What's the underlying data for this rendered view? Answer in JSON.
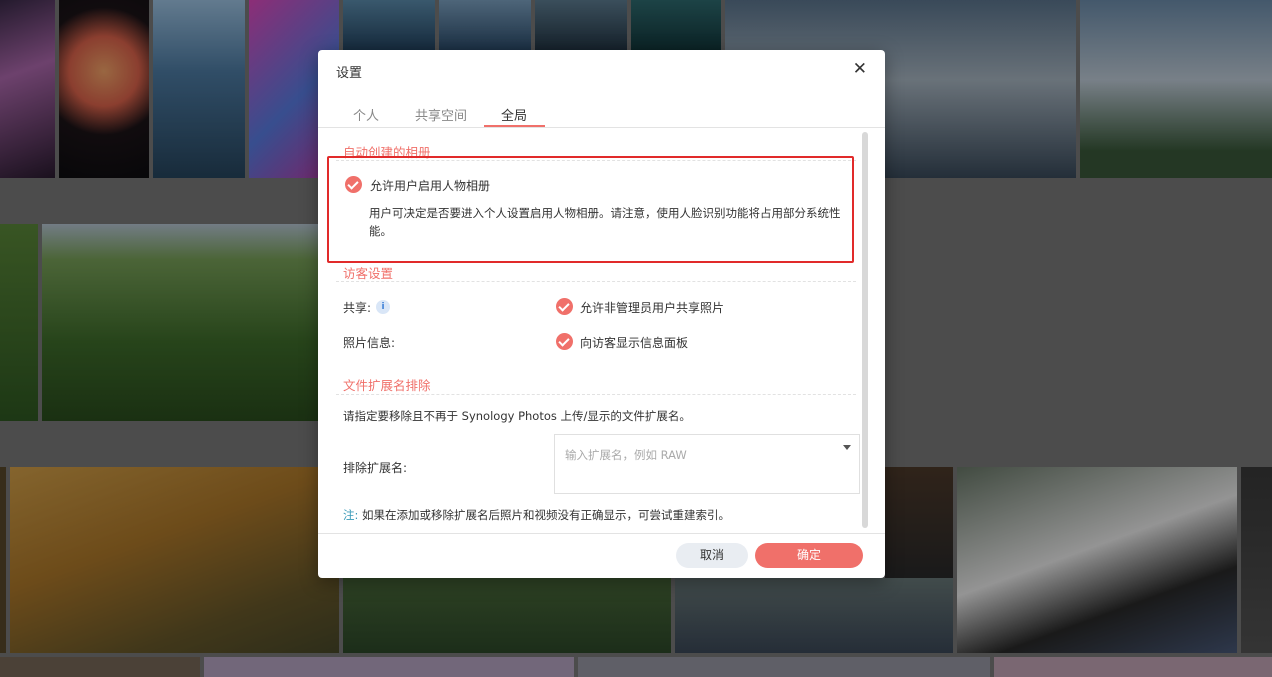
{
  "dialog": {
    "title": "设置",
    "close_icon": "✕",
    "tabs": [
      "个人",
      "共享空间",
      "全局"
    ],
    "active_tab": "全局"
  },
  "auto_album": {
    "section_title": "自动创建的相册",
    "option_label": "允许用户启用人物相册",
    "description": "用户可决定是否要进入个人设置启用人物相册。请注意，使用人脸识别功能将占用部分系统性能。"
  },
  "visitor": {
    "section_title": "访客设置",
    "share_label": "共享:",
    "share_option": "允许非管理员用户共享照片",
    "photo_info_label": "照片信息:",
    "photo_info_option": "向访客显示信息面板"
  },
  "ext_exclude": {
    "section_title": "文件扩展名排除",
    "intro": "请指定要移除且不再于 Synology Photos 上传/显示的文件扩展名。",
    "field_label": "排除扩展名:",
    "placeholder": "输入扩展名，例如 RAW",
    "note_label": "注:",
    "note_text": "如果在添加或移除扩展名后照片和视频没有正确显示，可尝试重建索引。"
  },
  "buttons": {
    "cancel": "取消",
    "ok": "确定"
  },
  "colors": {
    "accent": "#f0706a",
    "highlight_box": "#e12a2a",
    "note": "#3a9ab8"
  }
}
